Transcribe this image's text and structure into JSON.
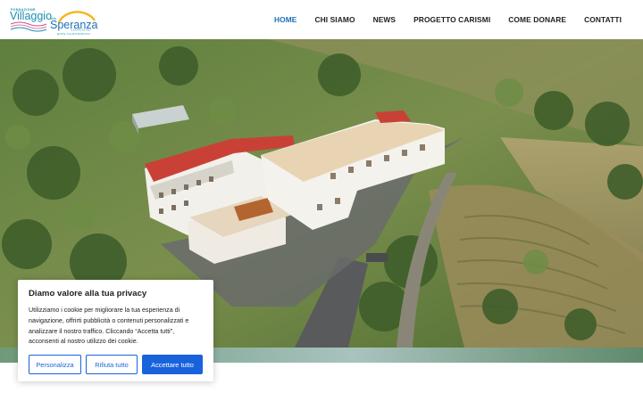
{
  "logo": {
    "fondazione": "FONDAZIONE",
    "villaggio": "Villaggio",
    "della": "della",
    "speranza": "Speranza",
    "tagline": "IL DOPO DI NOI",
    "ente": "ENTE FILANTROPICO",
    "colors": {
      "teal": "#1a8fb0",
      "blue": "#1d6fb8",
      "sun": "#f5b41c",
      "wave": "#d94a8b"
    }
  },
  "nav": {
    "items": [
      {
        "label": "HOME",
        "active": true
      },
      {
        "label": "CHI SIAMO",
        "active": false
      },
      {
        "label": "NEWS",
        "active": false
      },
      {
        "label": "PROGETTO CARISMI",
        "active": false
      },
      {
        "label": "COME DONARE",
        "active": false
      },
      {
        "label": "CONTATTI",
        "active": false
      }
    ],
    "active_color": "#1d6fb8"
  },
  "cookie_banner": {
    "title": "Diamo valore alla tua privacy",
    "text": "Utilizziamo i cookie per migliorare la tua esperienza di navigazione, offrirti pubblicità o contenuti personalizzati e analizzare il nostro traffico. Cliccando “Accetta tutti”, acconsenti al nostro utilizzo dei cookie.",
    "buttons": {
      "customize": "Personalizza",
      "reject": "Rifiuta tutto",
      "accept": "Accettare tutto"
    },
    "accent_color": "#1863dc"
  }
}
